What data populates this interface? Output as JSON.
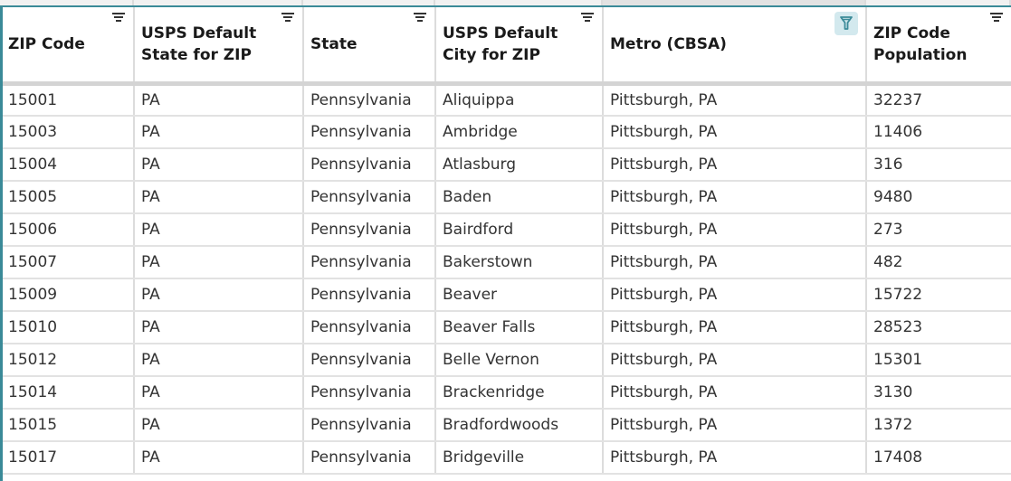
{
  "theme": {
    "accent": "#3a8a98",
    "active_filter_bg": "#d3e9ee",
    "active_filter_fg": "#3a8a98"
  },
  "table": {
    "columns": [
      {
        "label": "ZIP Code",
        "filter_active": false
      },
      {
        "label": "USPS Default State for ZIP",
        "filter_active": false
      },
      {
        "label": "State",
        "filter_active": false
      },
      {
        "label": "USPS Default City for ZIP",
        "filter_active": false
      },
      {
        "label": "Metro (CBSA)",
        "filter_active": true
      },
      {
        "label": "ZIP Code Population",
        "filter_active": false
      }
    ],
    "rows": [
      [
        "15001",
        "PA",
        "Pennsylvania",
        "Aliquippa",
        "Pittsburgh, PA",
        "32237"
      ],
      [
        "15003",
        "PA",
        "Pennsylvania",
        "Ambridge",
        "Pittsburgh, PA",
        "11406"
      ],
      [
        "15004",
        "PA",
        "Pennsylvania",
        "Atlasburg",
        "Pittsburgh, PA",
        "316"
      ],
      [
        "15005",
        "PA",
        "Pennsylvania",
        "Baden",
        "Pittsburgh, PA",
        "9480"
      ],
      [
        "15006",
        "PA",
        "Pennsylvania",
        "Bairdford",
        "Pittsburgh, PA",
        "273"
      ],
      [
        "15007",
        "PA",
        "Pennsylvania",
        "Bakerstown",
        "Pittsburgh, PA",
        "482"
      ],
      [
        "15009",
        "PA",
        "Pennsylvania",
        "Beaver",
        "Pittsburgh, PA",
        "15722"
      ],
      [
        "15010",
        "PA",
        "Pennsylvania",
        "Beaver Falls",
        "Pittsburgh, PA",
        "28523"
      ],
      [
        "15012",
        "PA",
        "Pennsylvania",
        "Belle Vernon",
        "Pittsburgh, PA",
        "15301"
      ],
      [
        "15014",
        "PA",
        "Pennsylvania",
        "Brackenridge",
        "Pittsburgh, PA",
        "3130"
      ],
      [
        "15015",
        "PA",
        "Pennsylvania",
        "Bradfordwoods",
        "Pittsburgh, PA",
        "1372"
      ],
      [
        "15017",
        "PA",
        "Pennsylvania",
        "Bridgeville",
        "Pittsburgh, PA",
        "17408"
      ]
    ]
  }
}
